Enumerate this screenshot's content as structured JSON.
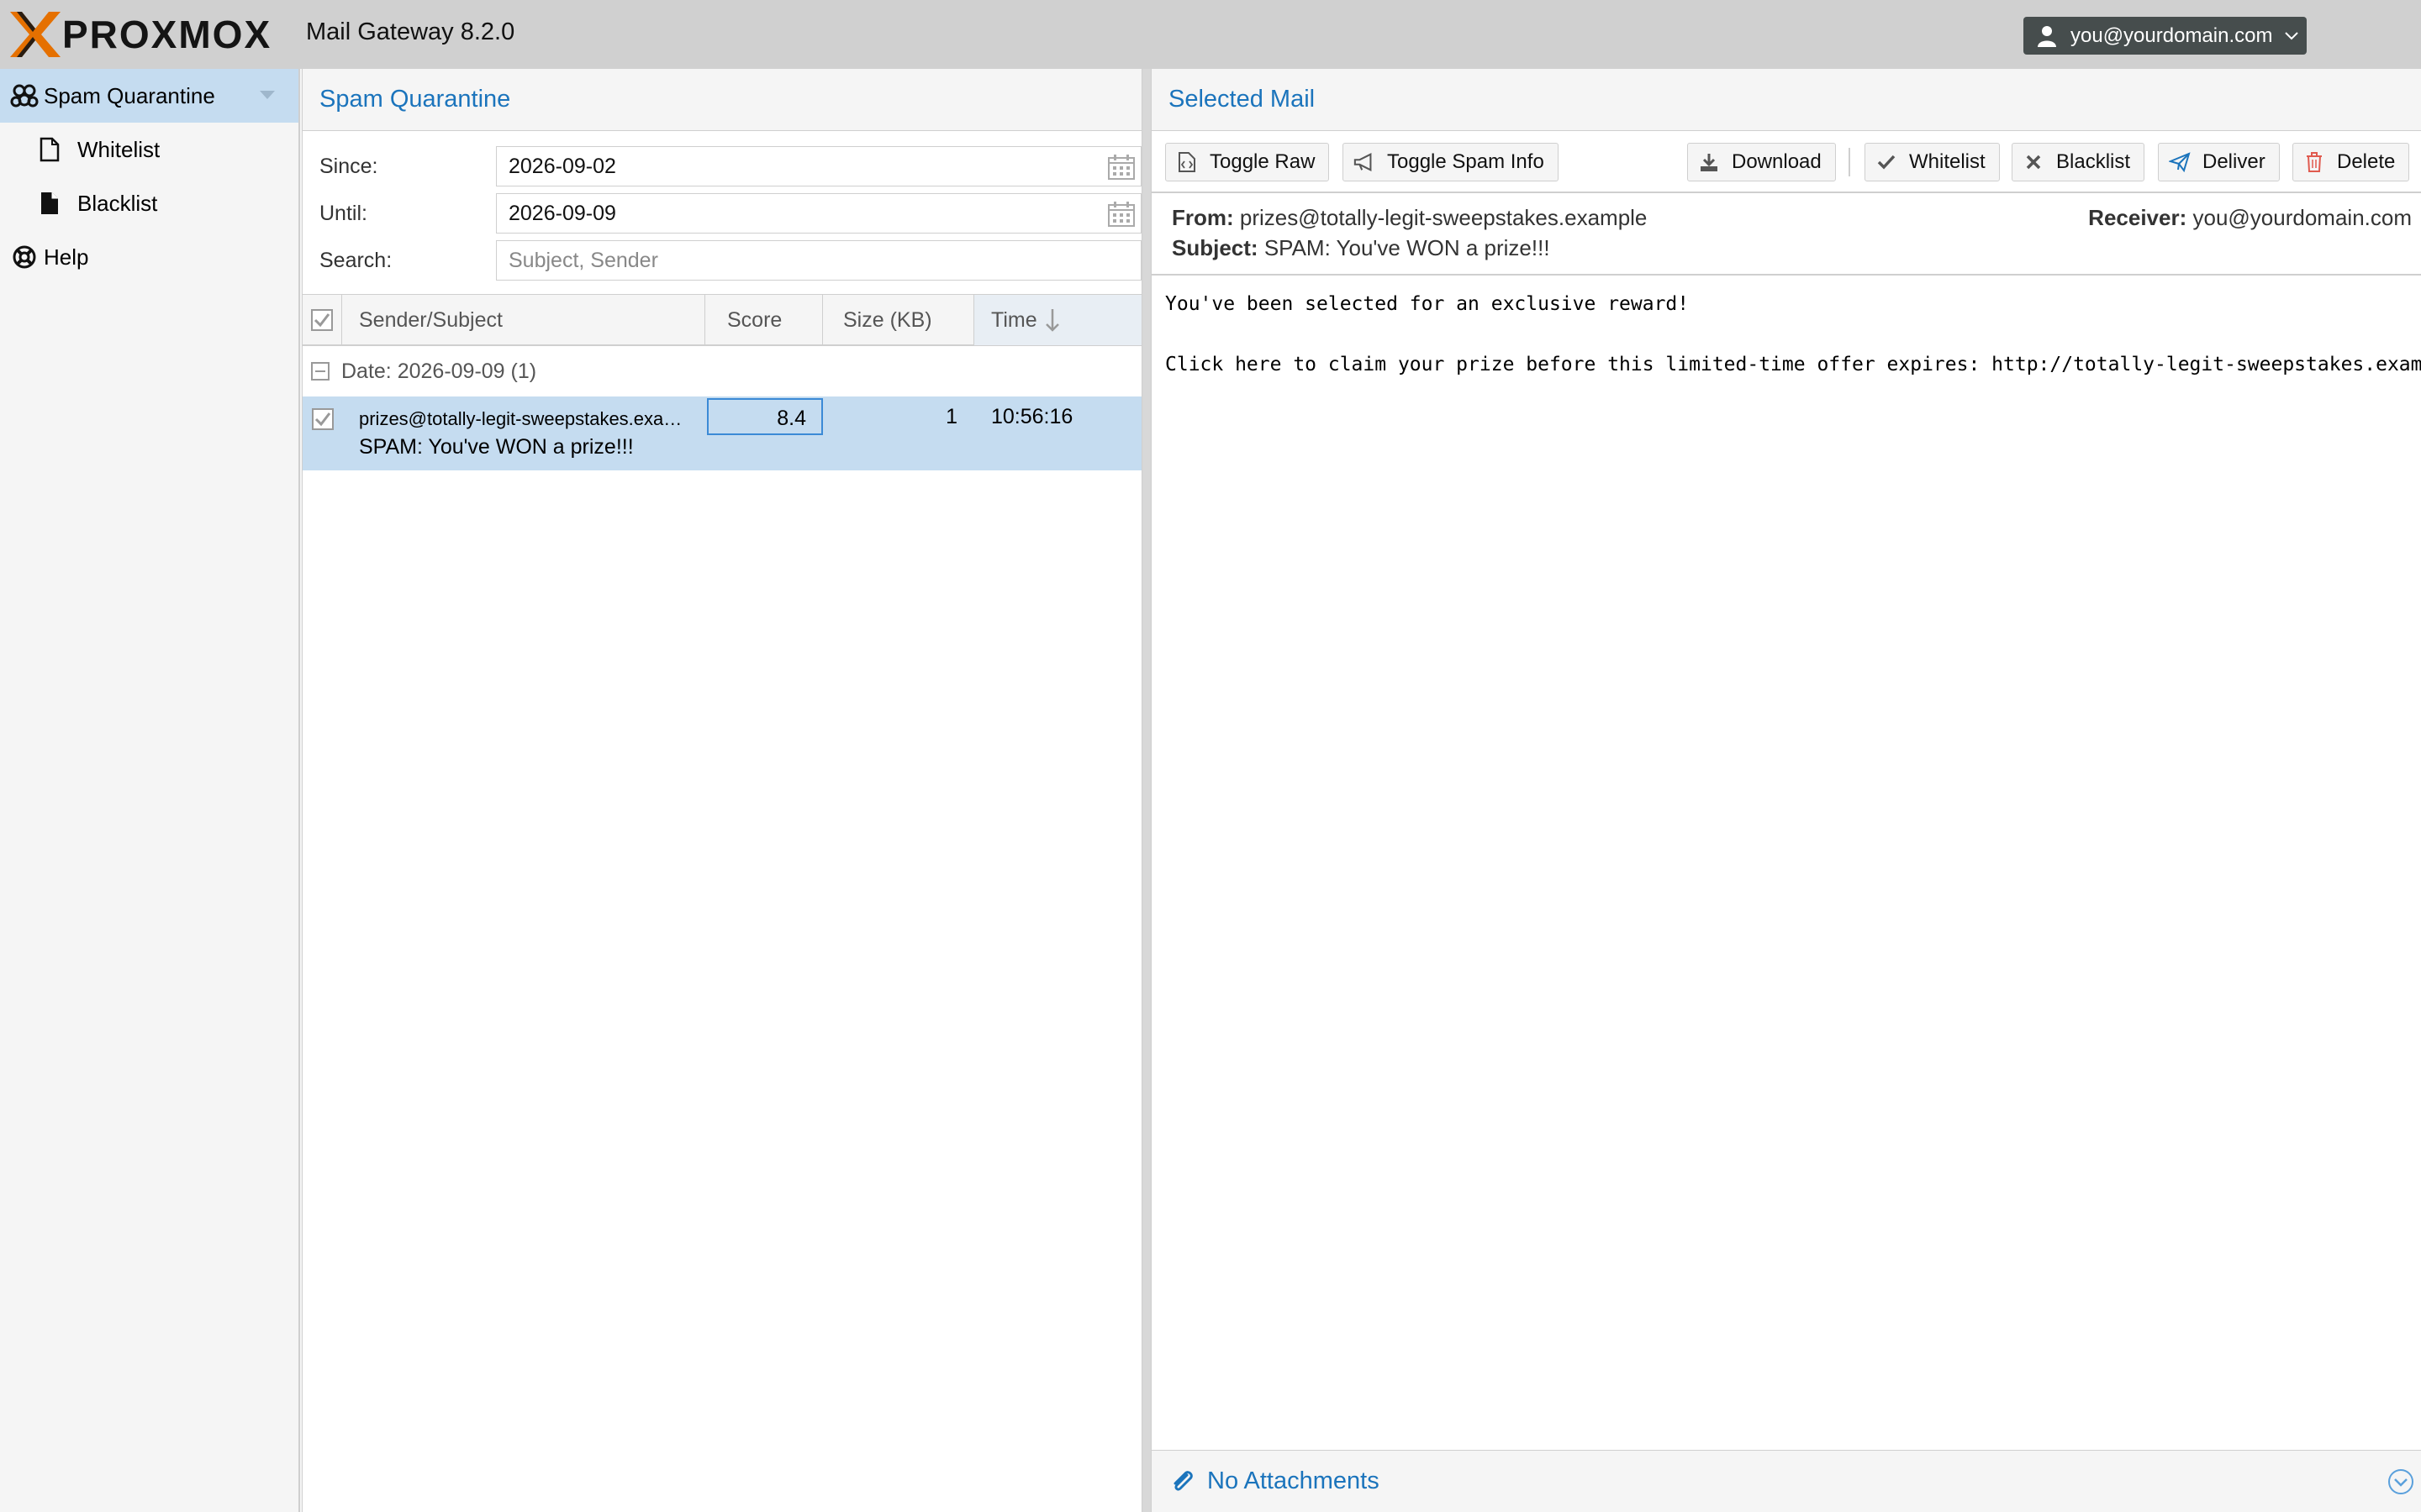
{
  "header": {
    "logo_text": "PROXMOX",
    "app_title": "Mail Gateway 8.2.0",
    "user": "you@yourdomain.com"
  },
  "nav": {
    "items": [
      {
        "label": "Spam Quarantine",
        "icon": "users-group-icon",
        "selected": true
      },
      {
        "label": "Whitelist",
        "icon": "file-outline-icon"
      },
      {
        "label": "Blacklist",
        "icon": "file-filled-icon"
      },
      {
        "label": "Help",
        "icon": "lifebuoy-icon"
      }
    ]
  },
  "quarantine": {
    "title": "Spam Quarantine",
    "since_label": "Since:",
    "since_value": "2026-09-02",
    "until_label": "Until:",
    "until_value": "2026-09-09",
    "search_label": "Search:",
    "search_placeholder": "Subject, Sender",
    "columns": [
      "Sender/Subject",
      "Score",
      "Size (KB)",
      "Time"
    ],
    "group_label": "Date: 2026-09-09 (1)",
    "rows": [
      {
        "sender": "prizes@totally-legit-sweepstakes.exa…",
        "subject": "SPAM: You've WON a prize!!!",
        "score": "8.4",
        "size": "1",
        "time": "10:56:16"
      }
    ]
  },
  "mail": {
    "title": "Selected Mail",
    "toolbar": {
      "toggle_raw": "Toggle Raw",
      "toggle_spam_info": "Toggle Spam Info",
      "download": "Download",
      "whitelist": "Whitelist",
      "blacklist": "Blacklist",
      "deliver": "Deliver",
      "delete": "Delete"
    },
    "from_label": "From:",
    "from_value": "prizes@totally-legit-sweepstakes.example",
    "subject_label": "Subject:",
    "subject_value": "SPAM: You've WON a prize!!!",
    "receiver_label": "Receiver:",
    "receiver_value": "you@yourdomain.com",
    "body_line1": "You've been selected for an exclusive reward!",
    "body_line2": "Click here to claim your prize before this limited-time offer expires: http://totally-legit-sweepstakes.example/cla",
    "attachments": "No Attachments"
  },
  "colors": {
    "accent": "#1b74bc",
    "selection": "#c5dcf0",
    "header_bg": "#d0d0d0",
    "user_button": "#464d4d",
    "logo_orange": "#e57000"
  }
}
